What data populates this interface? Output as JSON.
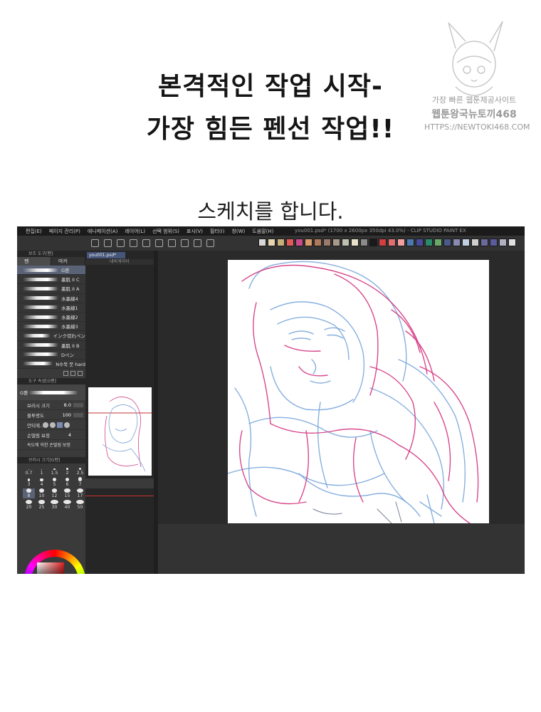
{
  "heading_line1": "본격적인 작업 시작-",
  "heading_line2": "가장 힘든 펜선 작업!!",
  "caption": "스케치를 합니다.",
  "watermark": {
    "line1": "가장 빠른 웹툰제공사이트",
    "line2": "웹툰왕국뉴토끼468",
    "line3": "HTTPS://NEWTOKI468.COM"
  },
  "app": {
    "menu": [
      "편집(E)",
      "페이지 관리(P)",
      "애니메이션(A)",
      "레이어(L)",
      "선택 범위(S)",
      "표시(V)",
      "필터(I)",
      "창(W)",
      "도움말(H)"
    ],
    "title_text": "you001.psd* (1700 x 2600px 350dpi 43.0%) - CLIP STUDIO PAINT EX",
    "palette_colors": [
      "#d8d8d8",
      "#e8d5b0",
      "#c8b07a",
      "#e05a5a",
      "#c94a8a",
      "#d89a6a",
      "#b07a5a",
      "#9a7a6a",
      "#a89a8a",
      "#c0c0b0",
      "#e8e0c8",
      "#8a8a8a",
      "#1a1a1a",
      "#d04040",
      "#e07070",
      "#f0a0a0",
      "#4a7ab0",
      "#4a4a9a",
      "#2a8a6a",
      "#6aa86a",
      "#4a5a8a",
      "#8a8ab0",
      "#c0d0e0",
      "#d0d0d0",
      "#6a6a9a",
      "#5a5aa0",
      "#b0b0c0",
      "#e0e0e0"
    ],
    "brush_panel": {
      "header": "보조 도구[펜]",
      "tabs": [
        "펜",
        "마커"
      ],
      "brushes": [
        "G펜",
        "墨肌 II  C",
        "墨肌 II  A",
        "水墨線4",
        "水墨線1",
        "水墨線2",
        "水墨線3",
        "インク切れペン",
        "墨肌 II  B",
        "Dペン",
        "N수묵 붓 hard"
      ]
    },
    "tool_property": {
      "header": "도구 속성[G펜]",
      "tool_name": "G펜",
      "brush_size_label": "브러시 크기",
      "brush_size_value": "8.0",
      "opacity_label": "불투명도",
      "opacity_value": "100",
      "antialias_label": "안티에...",
      "stabilization_label": "손떨림 보정",
      "stabilization_value": "4",
      "speed_label": "속도에 의한 손떨림 보정"
    },
    "brush_size_panel": {
      "header": "브러시 크기[G펜]",
      "sizes": [
        "0.7",
        "1",
        "1.5",
        "2",
        "2.5",
        "3",
        "4",
        "5",
        "6",
        "7",
        "8",
        "10",
        "12",
        "15",
        "17",
        "20",
        "25",
        "30",
        "40",
        "50"
      ]
    },
    "document_tab": "you001.psd*",
    "navigator_header": "내비게이터"
  }
}
